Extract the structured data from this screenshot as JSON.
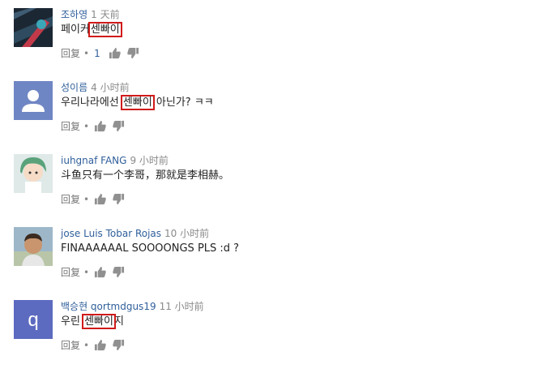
{
  "comments": [
    {
      "author": "조하영",
      "time": "1 天前",
      "pre": "페이커",
      "highlight": "센빠이",
      "post": "",
      "reply": "回复",
      "dot": "•",
      "likes": "1",
      "avatar": "dark-abstract-art"
    },
    {
      "author": "성이름",
      "time": "4 小时前",
      "pre": "우리나라에선 ",
      "highlight": "센빠이",
      "post": " 아닌가? ㅋㅋ",
      "reply": "回复",
      "dot": "•",
      "likes": "",
      "avatar": "default-person"
    },
    {
      "author": "iuhgnaf FANG",
      "time": "9 小时前",
      "pre": "斗鱼只有一个李哥，那就是李相赫。",
      "highlight": "",
      "post": "",
      "reply": "回复",
      "dot": "•",
      "likes": "",
      "avatar": "anime-girl"
    },
    {
      "author": "jose Luis Tobar Rojas",
      "time": "10 小时前",
      "pre": "FINAAAAAAL SOOOONGS PLS :d ?",
      "highlight": "",
      "post": "",
      "reply": "回复",
      "dot": "•",
      "likes": "",
      "avatar": "man-photo"
    },
    {
      "author": "백승현 qortmdgus19",
      "time": "11 小时前",
      "pre": "우린 ",
      "highlight": "센빠이",
      "post": "지",
      "reply": "回复",
      "dot": "•",
      "likes": "",
      "avatar": "letter-q"
    }
  ],
  "avatar_letter": "q",
  "colors": {
    "author": "#2f5f9a",
    "highlight_box": "#d11a1a",
    "time": "#8a8a8a"
  }
}
